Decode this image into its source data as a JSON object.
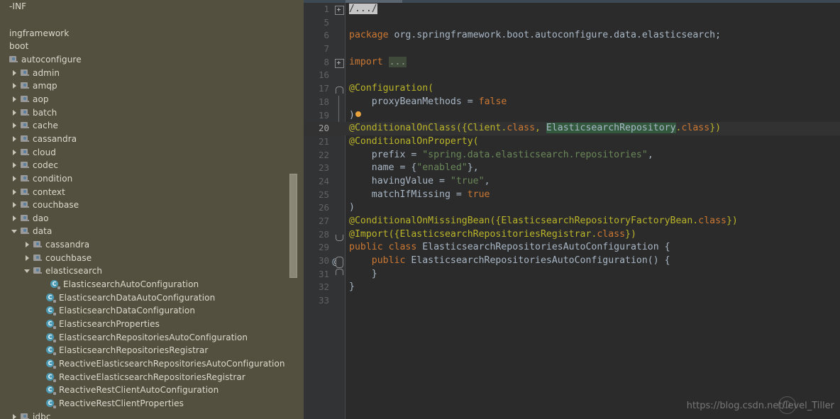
{
  "sidebar": {
    "scrollbar": {
      "name": "project-tree-scrollbar"
    },
    "items": [
      {
        "label": "-INF",
        "indent": 0,
        "toggle": "none",
        "icon": "none"
      },
      {
        "label": "",
        "indent": 0,
        "toggle": "none",
        "icon": "none"
      },
      {
        "label": "ingframework",
        "indent": 0,
        "toggle": "none",
        "icon": "none"
      },
      {
        "label": "boot",
        "indent": 0,
        "toggle": "none",
        "icon": "none"
      },
      {
        "label": "autoconfigure",
        "indent": 0,
        "toggle": "none",
        "icon": "package"
      },
      {
        "label": "admin",
        "indent": 16,
        "toggle": "closed",
        "icon": "package"
      },
      {
        "label": "amqp",
        "indent": 16,
        "toggle": "closed",
        "icon": "package"
      },
      {
        "label": "aop",
        "indent": 16,
        "toggle": "closed",
        "icon": "package"
      },
      {
        "label": "batch",
        "indent": 16,
        "toggle": "closed",
        "icon": "package"
      },
      {
        "label": "cache",
        "indent": 16,
        "toggle": "closed",
        "icon": "package"
      },
      {
        "label": "cassandra",
        "indent": 16,
        "toggle": "closed",
        "icon": "package"
      },
      {
        "label": "cloud",
        "indent": 16,
        "toggle": "closed",
        "icon": "package"
      },
      {
        "label": "codec",
        "indent": 16,
        "toggle": "closed",
        "icon": "package"
      },
      {
        "label": "condition",
        "indent": 16,
        "toggle": "closed",
        "icon": "package"
      },
      {
        "label": "context",
        "indent": 16,
        "toggle": "closed",
        "icon": "package"
      },
      {
        "label": "couchbase",
        "indent": 16,
        "toggle": "closed",
        "icon": "package"
      },
      {
        "label": "dao",
        "indent": 16,
        "toggle": "closed",
        "icon": "package"
      },
      {
        "label": "data",
        "indent": 16,
        "toggle": "open",
        "icon": "package"
      },
      {
        "label": "cassandra",
        "indent": 34,
        "toggle": "closed",
        "icon": "package"
      },
      {
        "label": "couchbase",
        "indent": 34,
        "toggle": "closed",
        "icon": "package"
      },
      {
        "label": "elasticsearch",
        "indent": 34,
        "toggle": "open",
        "icon": "package"
      },
      {
        "label": "ElasticsearchAutoConfiguration",
        "indent": 58,
        "toggle": "none",
        "icon": "class"
      },
      {
        "label": "ElasticsearchDataAutoConfiguration",
        "indent": 52,
        "toggle": "none",
        "icon": "class"
      },
      {
        "label": "ElasticsearchDataConfiguration",
        "indent": 52,
        "toggle": "none",
        "icon": "class"
      },
      {
        "label": "ElasticsearchProperties",
        "indent": 52,
        "toggle": "none",
        "icon": "class"
      },
      {
        "label": "ElasticsearchRepositoriesAutoConfiguration",
        "indent": 52,
        "toggle": "none",
        "icon": "class"
      },
      {
        "label": "ElasticsearchRepositoriesRegistrar",
        "indent": 52,
        "toggle": "none",
        "icon": "class"
      },
      {
        "label": "ReactiveElasticsearchRepositoriesAutoConfiguration",
        "indent": 52,
        "toggle": "none",
        "icon": "class"
      },
      {
        "label": "ReactiveElasticsearchRepositoriesRegistrar",
        "indent": 52,
        "toggle": "none",
        "icon": "class"
      },
      {
        "label": "ReactiveRestClientAutoConfiguration",
        "indent": 52,
        "toggle": "none",
        "icon": "class"
      },
      {
        "label": "ReactiveRestClientProperties",
        "indent": 52,
        "toggle": "none",
        "icon": "class"
      },
      {
        "label": "jdbc",
        "indent": 16,
        "toggle": "closed",
        "icon": "package"
      }
    ]
  },
  "editor": {
    "current_line": 20,
    "lines": [
      {
        "num": "1",
        "gutter": "plus",
        "tokens": [
          {
            "t": "/.../",
            "c": "fold-cmt"
          }
        ]
      },
      {
        "num": "5",
        "gutter": "",
        "tokens": []
      },
      {
        "num": "6",
        "gutter": "",
        "tokens": [
          {
            "t": "package",
            "c": "kw"
          },
          {
            "t": " org.springframework.boot.autoconfigure.data.elasticsearch;",
            "c": "ident"
          }
        ]
      },
      {
        "num": "7",
        "gutter": "",
        "tokens": []
      },
      {
        "num": "8",
        "gutter": "plus",
        "tokens": [
          {
            "t": "import",
            "c": "kw"
          },
          {
            "t": " ",
            "c": "ident"
          },
          {
            "t": "...",
            "c": "fold-text"
          }
        ]
      },
      {
        "num": "16",
        "gutter": "",
        "tokens": []
      },
      {
        "num": "17",
        "gutter": "minus-top",
        "tokens": [
          {
            "t": "@Configuration(",
            "c": "ann"
          }
        ]
      },
      {
        "num": "18",
        "gutter": "foldline",
        "tokens": [
          {
            "t": "    proxyBeanMethods = ",
            "c": "ident"
          },
          {
            "t": "false",
            "c": "kw"
          }
        ]
      },
      {
        "num": "19",
        "gutter": "foldline",
        "tokens": [
          {
            "t": ")",
            "c": "ident"
          },
          {
            "t": "BULB",
            "c": "bulb"
          }
        ]
      },
      {
        "num": "20",
        "gutter": "",
        "tokens": [
          {
            "t": "@ConditionalOnClass({Client.",
            "c": "ann"
          },
          {
            "t": "class",
            "c": "kw"
          },
          {
            "t": ", ",
            "c": "ann"
          },
          {
            "t": "ElasticsearchRepository",
            "c": "hl"
          },
          {
            "t": ".",
            "c": "ann"
          },
          {
            "t": "class",
            "c": "kw"
          },
          {
            "t": "})",
            "c": "ann"
          }
        ]
      },
      {
        "num": "21",
        "gutter": "",
        "tokens": [
          {
            "t": "@ConditionalOnProperty(",
            "c": "ann"
          }
        ]
      },
      {
        "num": "22",
        "gutter": "",
        "tokens": [
          {
            "t": "    prefix = ",
            "c": "ident"
          },
          {
            "t": "\"spring.data.elasticsearch.repositories\"",
            "c": "str"
          },
          {
            "t": ",",
            "c": "ident"
          }
        ]
      },
      {
        "num": "23",
        "gutter": "",
        "tokens": [
          {
            "t": "    name = {",
            "c": "ident"
          },
          {
            "t": "\"enabled\"",
            "c": "str"
          },
          {
            "t": "},",
            "c": "ident"
          }
        ]
      },
      {
        "num": "24",
        "gutter": "",
        "tokens": [
          {
            "t": "    havingValue = ",
            "c": "ident"
          },
          {
            "t": "\"true\"",
            "c": "str"
          },
          {
            "t": ",",
            "c": "ident"
          }
        ]
      },
      {
        "num": "25",
        "gutter": "",
        "tokens": [
          {
            "t": "    matchIfMissing = ",
            "c": "ident"
          },
          {
            "t": "true",
            "c": "kw"
          }
        ]
      },
      {
        "num": "26",
        "gutter": "",
        "tokens": [
          {
            "t": ")",
            "c": "ident"
          }
        ]
      },
      {
        "num": "27",
        "gutter": "",
        "tokens": [
          {
            "t": "@ConditionalOnMissingBean({ElasticsearchRepositoryFactoryBean.",
            "c": "ann"
          },
          {
            "t": "class",
            "c": "kw"
          },
          {
            "t": "})",
            "c": "ann"
          }
        ]
      },
      {
        "num": "28",
        "gutter": "foldcap",
        "tokens": [
          {
            "t": "@Import({ElasticsearchRepositoriesRegistrar.",
            "c": "ann"
          },
          {
            "t": "class",
            "c": "kw"
          },
          {
            "t": "})",
            "c": "ann"
          }
        ]
      },
      {
        "num": "29",
        "gutter": "",
        "tokens": [
          {
            "t": "public class ",
            "c": "kw"
          },
          {
            "t": "ElasticsearchRepositoriesAutoConfiguration {",
            "c": "ident"
          }
        ]
      },
      {
        "num": "30",
        "gutter": "at",
        "tokens": [
          {
            "t": "    ",
            "c": "ident"
          },
          {
            "t": "public ",
            "c": "kw"
          },
          {
            "t": "ElasticsearchRepositoriesAutoConfiguration() {",
            "c": "ident"
          }
        ]
      },
      {
        "num": "31",
        "gutter": "foldcap2",
        "tokens": [
          {
            "t": "    }",
            "c": "ident"
          }
        ]
      },
      {
        "num": "32",
        "gutter": "",
        "tokens": [
          {
            "t": "}",
            "c": "ident"
          }
        ]
      },
      {
        "num": "33",
        "gutter": "",
        "tokens": []
      }
    ]
  },
  "watermark": {
    "text": "https://blog.csdn.net/level_Tiller"
  }
}
